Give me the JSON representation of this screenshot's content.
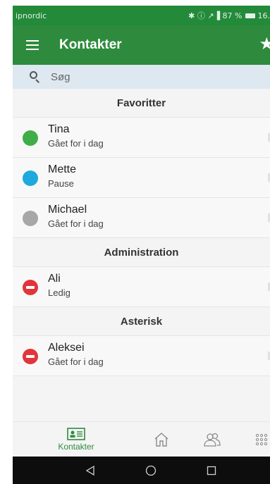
{
  "status_bar": {
    "carrier": "ipnordic",
    "indicators": "✱ ⓘ ↗▐ 87 %",
    "time": "16."
  },
  "app_bar": {
    "title": "Kontakter",
    "menu_icon": "hamburger-menu-icon",
    "action_icon": "star-icon"
  },
  "search": {
    "placeholder": "Søg",
    "value": ""
  },
  "sections": [
    {
      "title": "Favoritter",
      "contacts": [
        {
          "name": "Tina",
          "status": "Gået for i dag",
          "indicator_color": "#3fae49",
          "indicator": "dot"
        },
        {
          "name": "Mette",
          "status": "Pause",
          "indicator_color": "#1fa9dc",
          "indicator": "dot"
        },
        {
          "name": "Michael",
          "status": "Gået for i dag",
          "indicator_color": "#a7a7a7",
          "indicator": "dot"
        }
      ]
    },
    {
      "title": "Administration",
      "contacts": [
        {
          "name": "Ali",
          "status": "Ledig",
          "indicator_color": "#e2343b",
          "indicator": "minus"
        }
      ]
    },
    {
      "title": "Asterisk",
      "contacts": [
        {
          "name": "Aleksei",
          "status": "Gået for i dag",
          "indicator_color": "#e2343b",
          "indicator": "minus"
        }
      ]
    }
  ],
  "bottom_nav": {
    "contacts_label": "Kontakter",
    "active_color": "#2e8b3d",
    "items": [
      "contacts-card-icon",
      "home-icon",
      "groups-icon",
      "grid-icon"
    ]
  },
  "android_nav": [
    "back-icon",
    "home-circle-icon",
    "recents-icon"
  ],
  "colors": {
    "brand_green": "#2e8b3d",
    "search_bg": "#dde8f1"
  }
}
